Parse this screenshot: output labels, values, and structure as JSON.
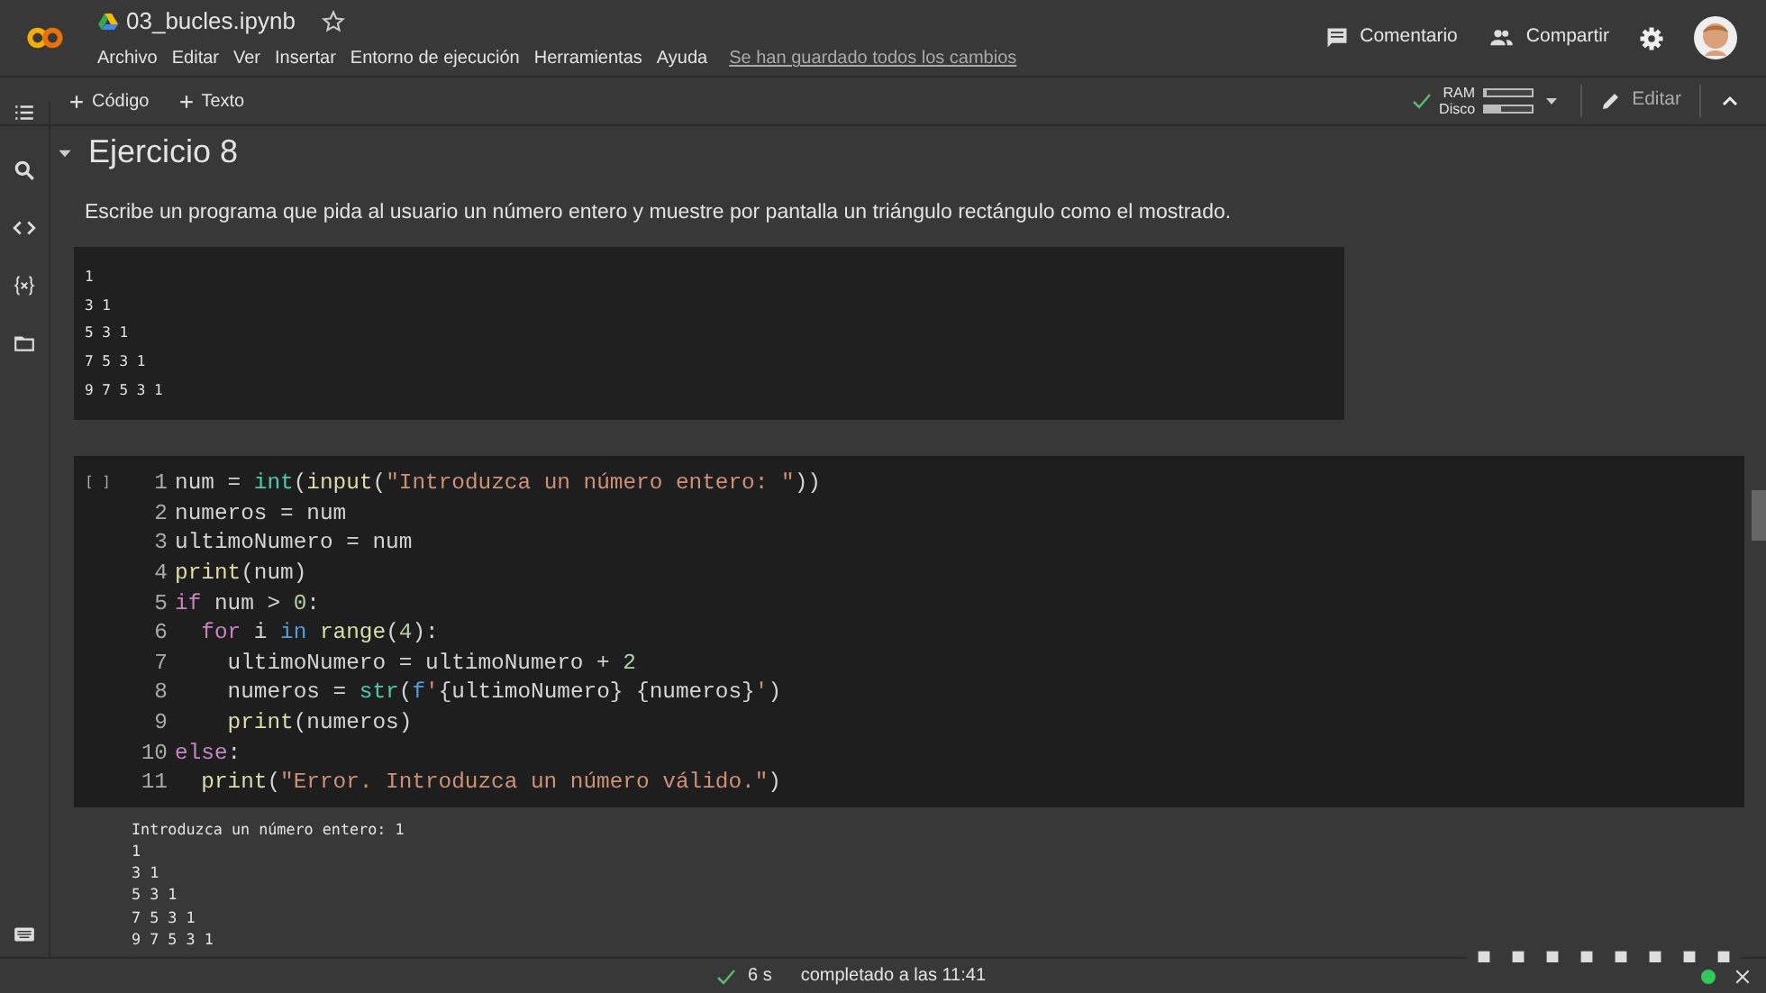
{
  "header": {
    "title": "03_bucles.ipynb",
    "starred": false,
    "menu": [
      "Archivo",
      "Editar",
      "Ver",
      "Insertar",
      "Entorno de ejecución",
      "Herramientas",
      "Ayuda"
    ],
    "save_status": "Se han guardado todos los cambios",
    "comment": "Comentario",
    "share": "Compartir"
  },
  "toolbar": {
    "add": [
      "Código",
      "Texto"
    ],
    "resources": [
      {
        "label": "RAM",
        "level": 0.05
      },
      {
        "label": "Disco",
        "level": 0.35
      }
    ],
    "connected": true,
    "edit": "Editar"
  },
  "section": {
    "expanded": true,
    "title": "Ejercicio 8",
    "description": "Escribe un programa que pida al usuario un número entero y muestre por pantalla un triángulo rectángulo como el mostrado.",
    "example": [
      "1",
      "3 1",
      "5 3 1",
      "7 5 3 1",
      "9 7 5 3 1"
    ]
  },
  "code_cell": {
    "run_marker": "[ ]",
    "lines": [
      {
        "number": "1",
        "tokens": [
          {
            "text": "num = ",
            "kind": "plain"
          },
          {
            "text": "int",
            "kind": "type"
          },
          {
            "text": "(",
            "kind": "plain"
          },
          {
            "text": "input",
            "kind": "func"
          },
          {
            "text": "(",
            "kind": "plain"
          },
          {
            "text": "\"Introduzca un número entero: \"",
            "kind": "string"
          },
          {
            "text": "))",
            "kind": "plain"
          }
        ]
      },
      {
        "number": "2",
        "tokens": [
          {
            "text": "numeros = num",
            "kind": "plain"
          }
        ]
      },
      {
        "number": "3",
        "tokens": [
          {
            "text": "ultimoNumero = num",
            "kind": "plain"
          }
        ]
      },
      {
        "number": "4",
        "tokens": [
          {
            "text": "print",
            "kind": "func"
          },
          {
            "text": "(num)",
            "kind": "plain"
          }
        ]
      },
      {
        "number": "5",
        "tokens": [
          {
            "text": "if",
            "kind": "control"
          },
          {
            "text": " num > ",
            "kind": "plain"
          },
          {
            "text": "0",
            "kind": "number"
          },
          {
            "text": ":",
            "kind": "plain"
          }
        ]
      },
      {
        "number": "6",
        "tokens": [
          {
            "text": "  for",
            "kind": "control"
          },
          {
            "text": " i ",
            "kind": "plain"
          },
          {
            "text": "in",
            "kind": "keyword"
          },
          {
            "text": " range",
            "kind": "func"
          },
          {
            "text": "(",
            "kind": "plain"
          },
          {
            "text": "4",
            "kind": "number"
          },
          {
            "text": "):",
            "kind": "plain"
          }
        ]
      },
      {
        "number": "7",
        "tokens": [
          {
            "text": "    ultimoNumero = ultimoNumero + ",
            "kind": "plain"
          },
          {
            "text": "2",
            "kind": "number"
          }
        ]
      },
      {
        "number": "8",
        "tokens": [
          {
            "text": "    numeros = ",
            "kind": "plain"
          },
          {
            "text": "str",
            "kind": "type"
          },
          {
            "text": "(",
            "kind": "plain"
          },
          {
            "text": "f",
            "kind": "keyword"
          },
          {
            "text": "'",
            "kind": "string"
          },
          {
            "text": "{ultimoNumero} {numeros}",
            "kind": "plain"
          },
          {
            "text": "'",
            "kind": "string"
          },
          {
            "text": ")",
            "kind": "plain"
          }
        ]
      },
      {
        "number": "9",
        "tokens": [
          {
            "text": "    print",
            "kind": "func"
          },
          {
            "text": "(numeros)",
            "kind": "plain"
          }
        ]
      },
      {
        "number": "10",
        "tokens": [
          {
            "text": "else",
            "kind": "control"
          },
          {
            "text": ":",
            "kind": "plain"
          }
        ]
      },
      {
        "number": "11",
        "tokens": [
          {
            "text": "  print",
            "kind": "func"
          },
          {
            "text": "(",
            "kind": "plain"
          },
          {
            "text": "\"Error. Introduzca un número válido.\"",
            "kind": "string"
          },
          {
            "text": ")",
            "kind": "plain"
          }
        ]
      }
    ],
    "output": [
      "Introduzca un número entero: 1",
      "1",
      "3 1",
      "5 3 1",
      "7 5 3 1",
      "9 7 5 3 1"
    ]
  },
  "status_bar": {
    "ok": true,
    "duration": "6 s",
    "message": "completado a las 11:41"
  }
}
